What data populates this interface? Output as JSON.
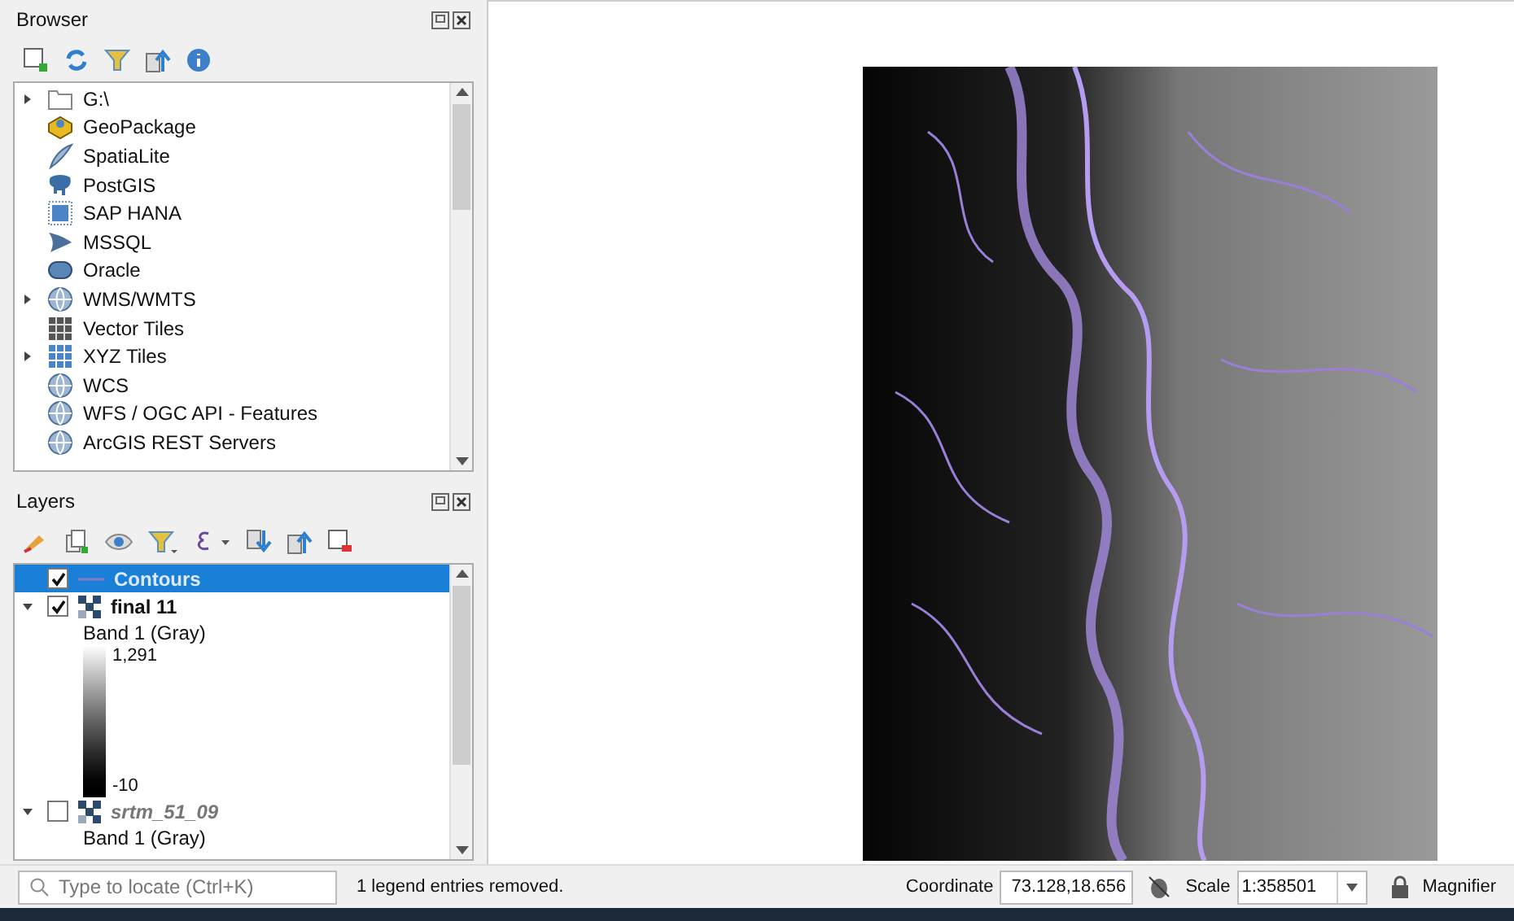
{
  "browser": {
    "title": "Browser",
    "items": [
      {
        "label": "G:\\",
        "expandable": true
      },
      {
        "label": "GeoPackage",
        "expandable": false
      },
      {
        "label": "SpatiaLite",
        "expandable": false
      },
      {
        "label": "PostGIS",
        "expandable": false
      },
      {
        "label": "SAP HANA",
        "expandable": false
      },
      {
        "label": "MSSQL",
        "expandable": false
      },
      {
        "label": "Oracle",
        "expandable": false
      },
      {
        "label": "WMS/WMTS",
        "expandable": true
      },
      {
        "label": "Vector Tiles",
        "expandable": false
      },
      {
        "label": "XYZ Tiles",
        "expandable": true
      },
      {
        "label": "WCS",
        "expandable": false
      },
      {
        "label": "WFS / OGC API - Features",
        "expandable": false
      },
      {
        "label": "ArcGIS REST Servers",
        "expandable": false
      }
    ]
  },
  "layers": {
    "title": "Layers",
    "items": [
      {
        "name": "Contours",
        "kind": "vector",
        "checked": true,
        "selected": true
      },
      {
        "name": "final 11",
        "kind": "raster",
        "checked": true,
        "selected": false,
        "expanded": true,
        "legend": {
          "band": "Band 1 (Gray)",
          "max": "1,291",
          "min": "-10"
        }
      },
      {
        "name": "srtm_51_09",
        "kind": "raster",
        "checked": false,
        "selected": false,
        "expanded": true,
        "legend": {
          "band": "Band 1 (Gray)"
        }
      }
    ]
  },
  "status_bar": {
    "locate_placeholder": "Type to locate (Ctrl+K)",
    "message": "1 legend entries removed.",
    "coordinate_label": "Coordinate",
    "coordinate": "73.128,18.656",
    "scale_label": "Scale",
    "scale": "1:358501",
    "magnifier_label": "Magnifier"
  }
}
